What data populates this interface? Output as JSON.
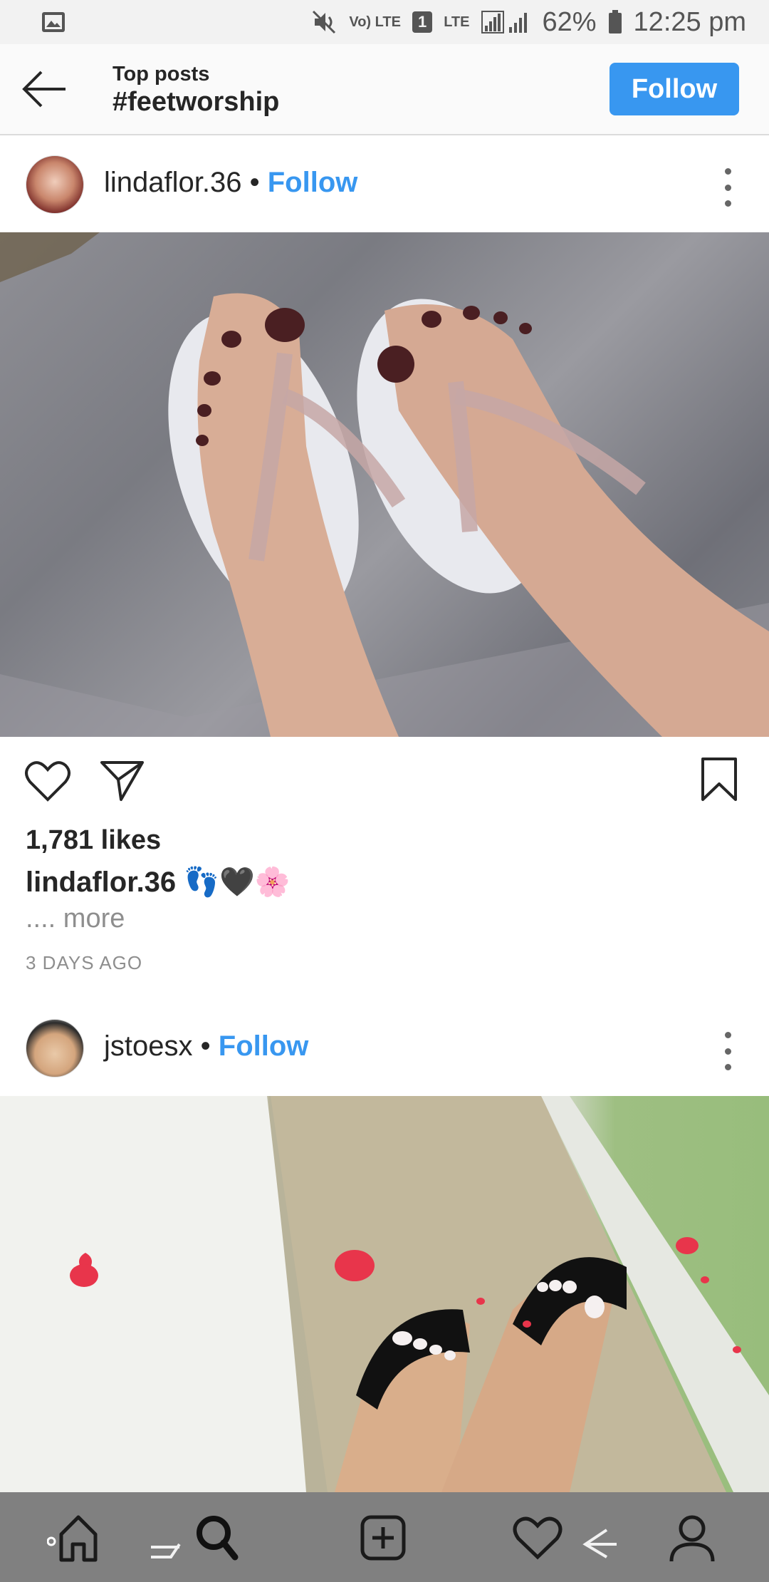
{
  "status_bar": {
    "image_icon": "image-icon",
    "volte": "Vo) LTE",
    "sim": "1",
    "lte": "LTE",
    "battery": "62%",
    "time": "12:25 pm"
  },
  "header": {
    "subtitle": "Top posts",
    "title": "#feetworship",
    "follow_label": "Follow"
  },
  "posts": [
    {
      "username": "lindaflor.36",
      "separator": "•",
      "follow_label": "Follow",
      "likes": "1,781 likes",
      "caption_user": "lindaflor.36",
      "caption_text": "👣🖤🌸",
      "more": ".... more",
      "time_ago": "3 DAYS AGO"
    },
    {
      "username": "jstoesx",
      "separator": "•",
      "follow_label": "Follow"
    }
  ],
  "colors": {
    "accent": "#3897f0",
    "muted": "#8e8e8e",
    "nav_bg": "#808080"
  }
}
